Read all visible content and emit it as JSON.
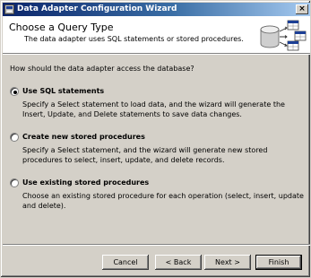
{
  "window": {
    "title": "Data Adapter Configuration Wizard",
    "close_glyph": "×"
  },
  "header": {
    "title": "Choose a Query Type",
    "subtitle": "The data adapter uses SQL statements or stored procedures."
  },
  "question": "How should the data adapter access the database?",
  "options": [
    {
      "label": "Use SQL statements",
      "selected": true,
      "description": "Specify a Select statement to load data, and the wizard will generate the Insert, Update, and Delete statements to save data changes."
    },
    {
      "label": "Create new stored procedures",
      "selected": false,
      "description": "Specify a Select statement, and the wizard will generate new stored procedures to select, insert, update, and delete records."
    },
    {
      "label": "Use existing stored procedures",
      "selected": false,
      "description": "Choose an existing stored procedure for each operation (select, insert, update and delete)."
    }
  ],
  "buttons": {
    "cancel": "Cancel",
    "back": "< Back",
    "next": "Next >",
    "finish": "Finish"
  },
  "icons": {
    "app": "wizard-app-icon",
    "header": "database-tables-icon"
  },
  "colors": {
    "titlebar_start": "#0a246a",
    "titlebar_end": "#a6caf0",
    "face": "#d4d0c8"
  }
}
